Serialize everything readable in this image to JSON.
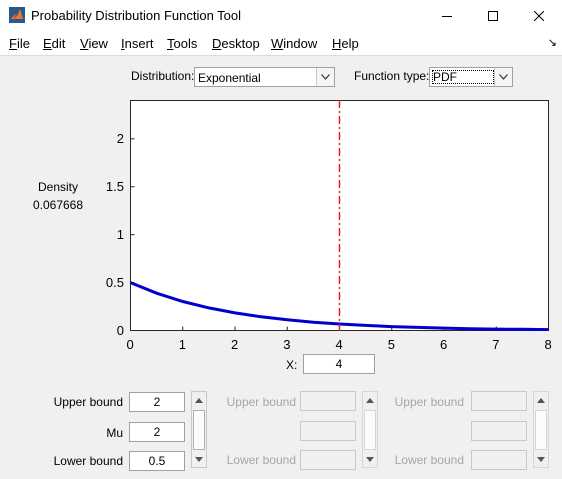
{
  "window": {
    "title": "Probability Distribution Function Tool"
  },
  "menu": [
    "File",
    "Edit",
    "View",
    "Insert",
    "Tools",
    "Desktop",
    "Window",
    "Help"
  ],
  "controls": {
    "distribution_label": "Distribution:",
    "distribution_value": "Exponential",
    "function_type_label": "Function type:",
    "function_type_value": "PDF"
  },
  "readout": {
    "density_label": "Density",
    "density_value": "0.067668",
    "x_label": "X:",
    "x_value": "4"
  },
  "params": {
    "col1": {
      "upper_label": "Upper bound",
      "upper_value": "2",
      "name_label": "Mu",
      "name_value": "2",
      "lower_label": "Lower bound",
      "lower_value": "0.5"
    },
    "col2": {
      "upper_label": "Upper bound",
      "lower_label": "Lower bound"
    },
    "col3": {
      "upper_label": "Upper bound",
      "lower_label": "Lower bound"
    }
  },
  "chart_data": {
    "type": "line",
    "function": "exponential pdf, mu = 2",
    "xlim": [
      0,
      8
    ],
    "ylim": [
      0,
      2.4
    ],
    "x_ticks": [
      "0",
      "1",
      "2",
      "3",
      "4",
      "5",
      "6",
      "7",
      "8"
    ],
    "y_ticks": [
      "0",
      "0.5",
      "1",
      "1.5",
      "2"
    ],
    "series": [
      {
        "x": [
          0,
          0.5,
          1,
          1.5,
          2,
          2.5,
          3,
          3.5,
          4,
          4.5,
          5,
          5.5,
          6,
          6.5,
          7,
          7.5,
          8
        ],
        "y": [
          0.5,
          0.389,
          0.303,
          0.236,
          0.184,
          0.143,
          0.112,
          0.087,
          0.068,
          0.053,
          0.041,
          0.032,
          0.025,
          0.019,
          0.015,
          0.012,
          0.009
        ]
      }
    ],
    "marker_x": 4,
    "line_color": "#0000cc",
    "marker_color": "#e0202a",
    "grid": false
  }
}
